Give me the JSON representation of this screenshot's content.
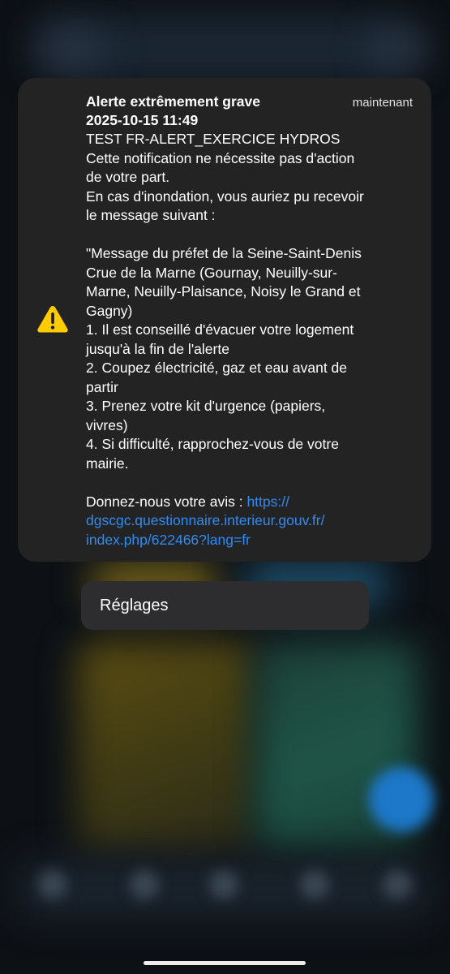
{
  "alert": {
    "title": "Alerte extrêmement grave",
    "time_label": "maintenant",
    "datetime": "2025-10-15 11:49",
    "lines": [
      "TEST FR-ALERT_EXERCICE HYDROS",
      "Cette notification ne nécessite pas d'action",
      "de votre part.",
      "En cas d'inondation, vous auriez pu recevoir",
      "le message suivant :",
      "",
      "\"Message du préfet de la Seine-Saint-Denis",
      "Crue de la Marne (Gournay, Neuilly-sur-",
      "Marne, Neuilly-Plaisance, Noisy le Grand et",
      "Gagny)",
      "1. Il est conseillé d'évacuer votre logement",
      "jusqu'à la fin de l'alerte",
      "2. Coupez électricité, gaz et eau avant de",
      "partir",
      "3. Prenez votre kit d'urgence (papiers,",
      "vivres)",
      "4. Si difficulté, rapprochez-vous de votre",
      "mairie.",
      ""
    ],
    "feedback_prefix": "Donnez-nous votre avis : ",
    "link_part1": "https://",
    "link_part2": "dgscgc.questionnaire.interieur.gouv.fr/",
    "link_part3": "index.php/622466?lang=fr",
    "icon": "warning-triangle-icon"
  },
  "menu": {
    "settings_label": "Réglages"
  },
  "colors": {
    "card_bg": "#232323",
    "link": "#2f8cf4",
    "warning": "#ffcc00"
  }
}
